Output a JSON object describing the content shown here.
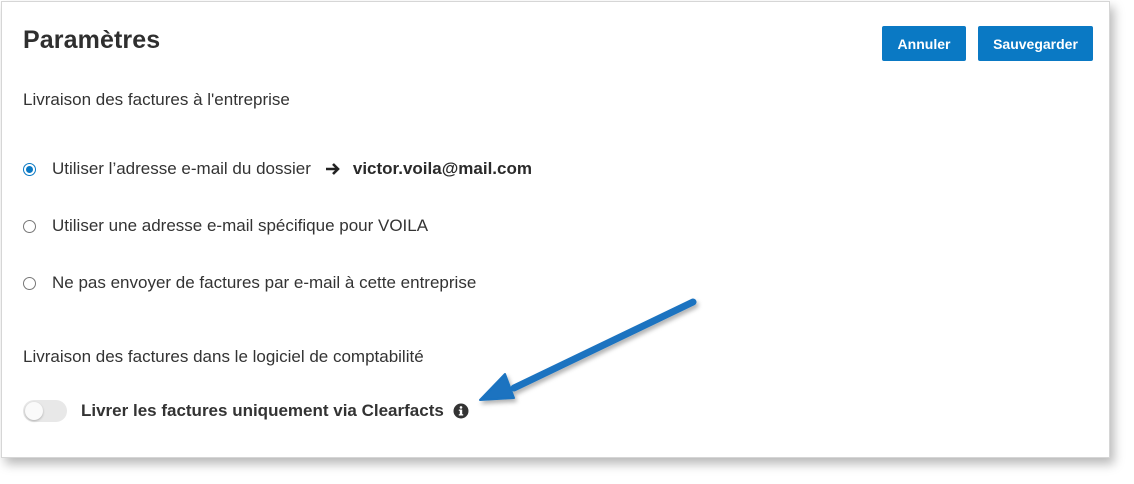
{
  "header": {
    "title": "Paramètres",
    "cancel_label": "Annuler",
    "save_label": "Sauvegarder"
  },
  "invoice_delivery": {
    "section_label": "Livraison des factures à l'entreprise",
    "options": [
      {
        "label": "Utiliser l’adresse e-mail du dossier",
        "selected": true,
        "email": "victor.voila@mail.com"
      },
      {
        "label": "Utiliser une adresse e-mail spécifique pour VOILA",
        "selected": false
      },
      {
        "label": "Ne pas envoyer de factures par e-mail à cette entreprise",
        "selected": false
      }
    ]
  },
  "accounting_delivery": {
    "section_label": "Livraison des factures dans le logiciel de comptabilité",
    "toggle_label": "Livrer les factures uniquement via Clearfacts",
    "toggle_on": false,
    "info_icon": "info-circle-icon"
  },
  "annotation": {
    "arrow_color": "#1a73c0"
  },
  "colors": {
    "accent": "#0a79c4"
  }
}
